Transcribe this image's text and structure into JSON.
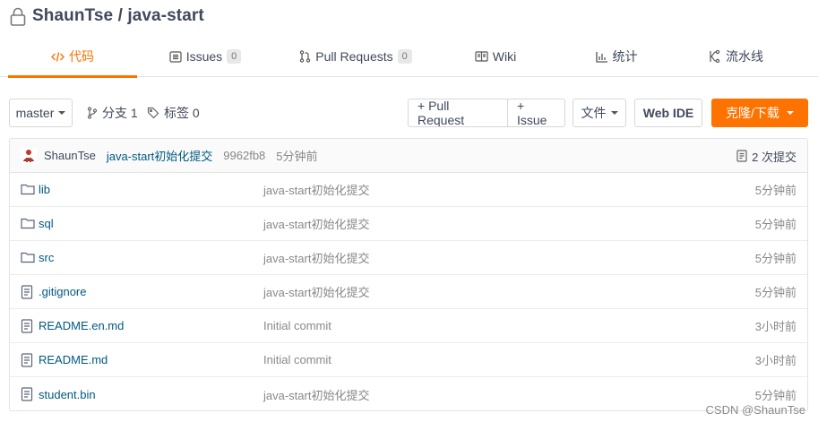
{
  "repo": {
    "owner": "ShaunTse",
    "name": "java-start",
    "title": "ShaunTse / java-start"
  },
  "tabs": [
    {
      "label": "代码",
      "icon": "code-icon",
      "active": true
    },
    {
      "label": "Issues",
      "icon": "issues-icon",
      "badge": "0"
    },
    {
      "label": "Pull Requests",
      "icon": "pull-request-icon",
      "badge": "0"
    },
    {
      "label": "Wiki",
      "icon": "book-icon"
    },
    {
      "label": "统计",
      "icon": "bar-chart-icon"
    },
    {
      "label": "流水线",
      "icon": "pipeline-icon"
    }
  ],
  "toolbar": {
    "branch": "master",
    "branches_label": "分支 1",
    "tags_label": "标签 0",
    "new_pr": "+ Pull Request",
    "new_issue": "+ Issue",
    "file_menu": "文件",
    "web_ide": "Web IDE",
    "clone": "克隆/下载"
  },
  "commit": {
    "author": "ShaunTse",
    "message": "java-start初始化提交",
    "sha": "9962fb8",
    "time": "5分钟前",
    "count_label": "2 次提交"
  },
  "files": [
    {
      "name": "lib",
      "type": "folder",
      "message": "java-start初始化提交",
      "time": "5分钟前"
    },
    {
      "name": "sql",
      "type": "folder",
      "message": "java-start初始化提交",
      "time": "5分钟前"
    },
    {
      "name": "src",
      "type": "folder",
      "message": "java-start初始化提交",
      "time": "5分钟前"
    },
    {
      "name": ".gitignore",
      "type": "file",
      "message": "java-start初始化提交",
      "time": "5分钟前"
    },
    {
      "name": "README.en.md",
      "type": "file",
      "message": "Initial commit",
      "time": "3小时前"
    },
    {
      "name": "README.md",
      "type": "file",
      "message": "Initial commit",
      "time": "3小时前"
    },
    {
      "name": "student.bin",
      "type": "file",
      "message": "java-start初始化提交",
      "time": "5分钟前"
    }
  ],
  "watermark": "CSDN @ShaunTse",
  "colors": {
    "accent": "#fe7300",
    "link": "#005980",
    "text": "#40485b",
    "muted": "#888888"
  }
}
